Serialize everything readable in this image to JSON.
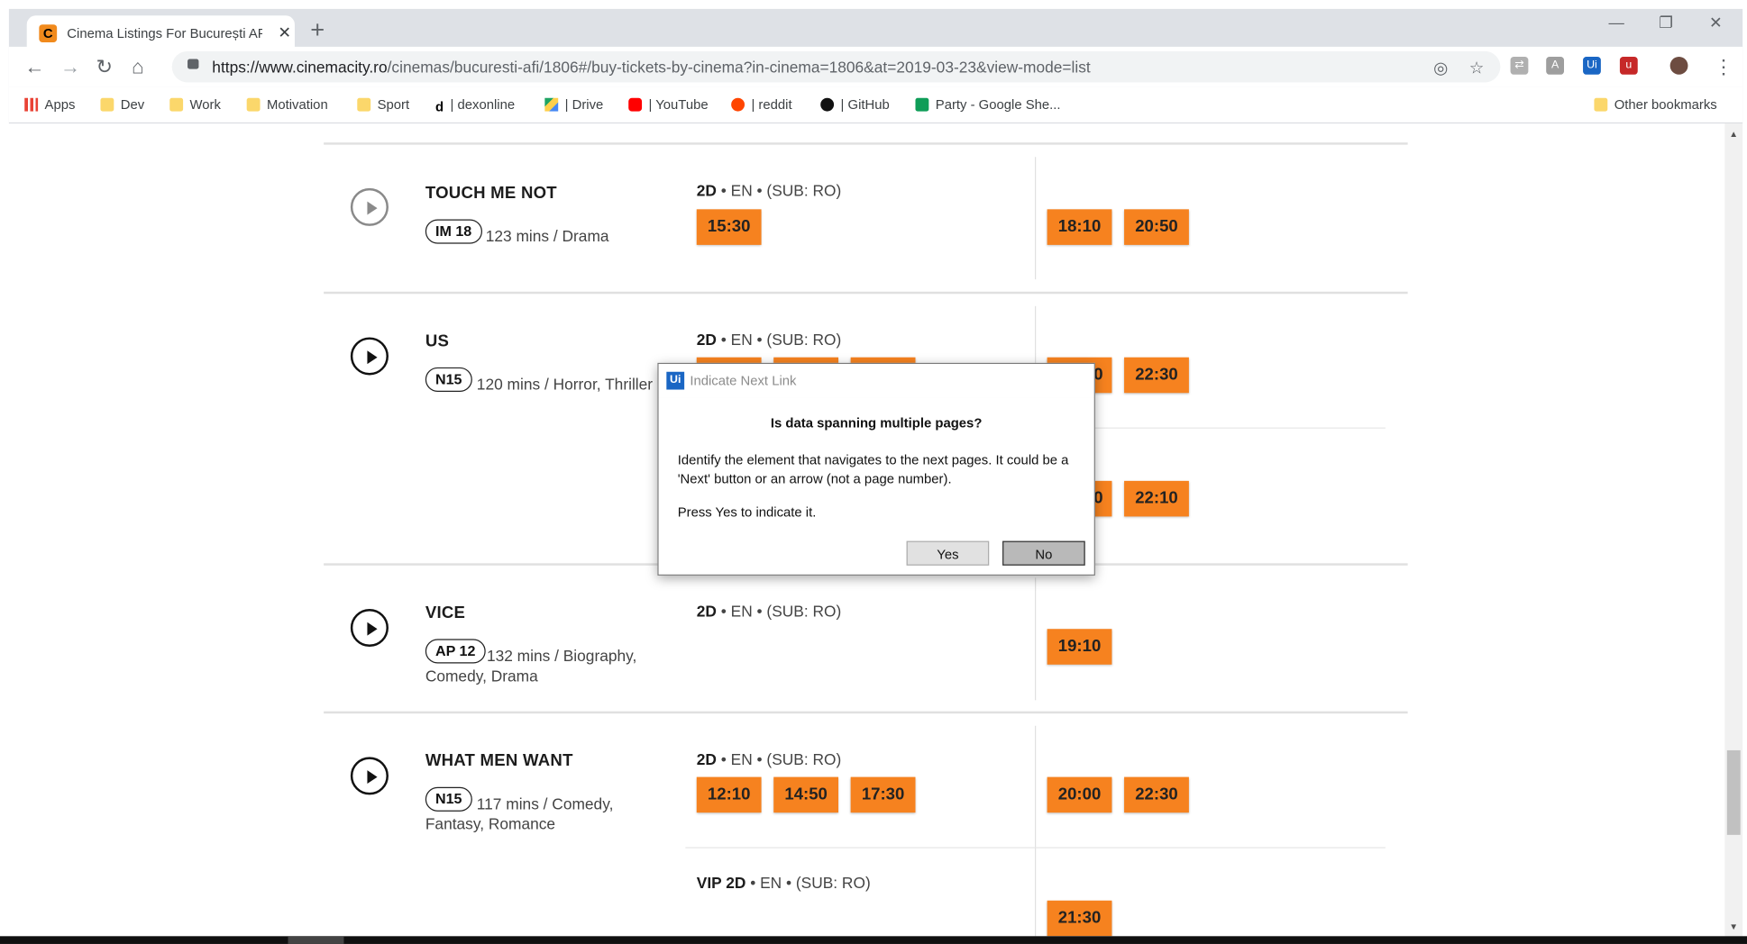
{
  "browser": {
    "tab_title": "Cinema Listings For București AFI",
    "tab_favicon": "C",
    "url_host": "https://www.cinemacity.ro",
    "url_rest": "/cinemas/bucuresti-afi/1806#/buy-tickets-by-cinema?in-cinema=1806&at=2019-03-23&view-mode=list",
    "bookmarks": [
      {
        "label": "Apps",
        "icon": "apps-icon"
      },
      {
        "label": "Dev",
        "icon": "folder-icon"
      },
      {
        "label": "Work",
        "icon": "folder-icon"
      },
      {
        "label": "Motivation",
        "icon": "folder-icon"
      },
      {
        "label": "Sport",
        "icon": "folder-icon"
      },
      {
        "label": "| dexonline",
        "icon": "dexonline-icon"
      },
      {
        "label": "| Drive",
        "icon": "drive-icon"
      },
      {
        "label": "| YouTube",
        "icon": "youtube-icon"
      },
      {
        "label": "| reddit",
        "icon": "reddit-icon"
      },
      {
        "label": "| GitHub",
        "icon": "github-icon"
      },
      {
        "label": "Party - Google She...",
        "icon": "sheets-icon"
      }
    ],
    "other_bookmarks": "Other bookmarks"
  },
  "movies": [
    {
      "title": "TOUCH ME NOT",
      "rating": "IM 18",
      "meta": "123 mins / Drama",
      "format_bold": "2D",
      "format_rest": " • EN • (SUB:  RO)",
      "times_left": [
        "15:30"
      ],
      "times_right": [
        "18:10",
        "20:50"
      ]
    },
    {
      "title": "US",
      "rating": "N15",
      "meta": "120 mins / Horror, Thriller",
      "format_bold": "2D",
      "format_rest": " • EN • (SUB:  RO)",
      "times_right": [
        "0",
        "22:30"
      ],
      "times_right2": [
        "0",
        "22:10"
      ]
    },
    {
      "title": "VICE",
      "rating": "AP 12",
      "meta": "132 mins / Biography, Comedy, Drama",
      "format_bold": "2D",
      "format_rest": " • EN • (SUB:  RO)",
      "times_right": [
        "19:10"
      ]
    },
    {
      "title": "WHAT MEN WANT",
      "rating": "N15",
      "meta": "117 mins / Comedy, Fantasy, Romance",
      "format_bold": "2D",
      "format_rest": " • EN • (SUB:  RO)",
      "times_left": [
        "12:10",
        "14:50",
        "17:30"
      ],
      "times_right": [
        "20:00",
        "22:30"
      ],
      "format2_bold": "VIP 2D",
      "format2_rest": " • EN • (SUB:  RO)",
      "times_vip": [
        "21:30"
      ]
    }
  ],
  "dialog": {
    "title": "Indicate Next Link",
    "icon_text": "Ui",
    "question": "Is data spanning multiple pages?",
    "message": "Identify the element that navigates to the next pages. It could be a 'Next' button or an arrow (not a page number).",
    "prompt": "Press Yes to indicate it.",
    "yes_label": "Yes",
    "no_label": "No"
  }
}
